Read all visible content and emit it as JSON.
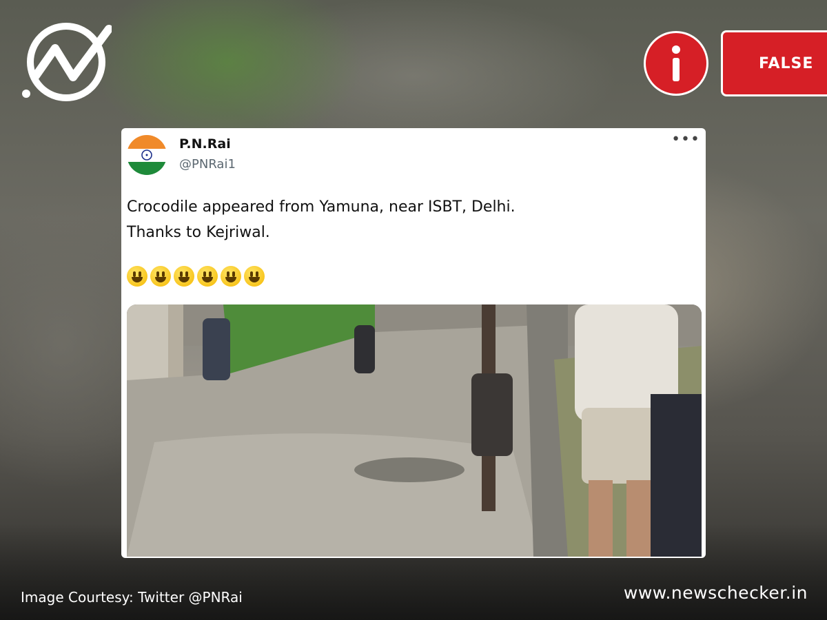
{
  "badge": {
    "verdict_label": "FALSE",
    "color": "#d61f26"
  },
  "tweet": {
    "name": "P.N.Rai",
    "handle": "@PNRai1",
    "more_icon": "more-options-icon",
    "text_lines": [
      "Crocodile appeared from Yamuna, near ISBT, Delhi.",
      "Thanks to Kejriwal."
    ],
    "emoji_name": "smiley-emoji",
    "emoji_count": 6
  },
  "footer": {
    "credit": "Image Courtesy: Twitter @PNRai",
    "site": "www.newschecker.in"
  }
}
